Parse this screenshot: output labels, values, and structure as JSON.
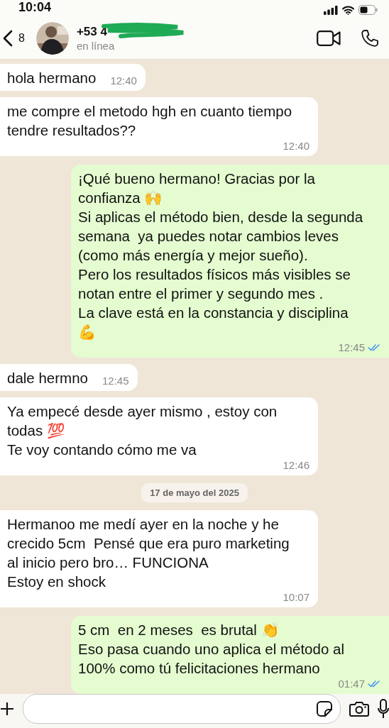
{
  "status_bar": {
    "time": "10:04"
  },
  "header": {
    "back_count": "8",
    "contact_name": "+53 4",
    "name_redacted": true,
    "presence": "en línea"
  },
  "messages": [
    {
      "kind": "message",
      "outgoing": false,
      "text": "hola hermano",
      "time": "12:40"
    },
    {
      "kind": "message",
      "outgoing": false,
      "text": "me compre el metodo hgh en cuanto tiempo\ntendre resultados??",
      "time": "12:40"
    },
    {
      "kind": "message",
      "outgoing": true,
      "text": "¡Qué bueno hermano! Gracias por la\nconfianza 🙌\nSi aplicas el método bien, desde la segunda\nsemana  ya puedes notar cambios leves\n(como más energía y mejor sueño).\nPero los resultados físicos más visibles se\nnotan entre el primer y segundo mes .\nLa clave está en la constancia y disciplina\n💪",
      "time": "12:45",
      "read": true
    },
    {
      "kind": "message",
      "outgoing": false,
      "text": "dale hermno",
      "time": "12:45"
    },
    {
      "kind": "message",
      "outgoing": false,
      "text": "Ya empecé desde ayer mismo , estoy con\ntodas 💯\nTe voy contando cómo me va",
      "time": "12:46"
    },
    {
      "kind": "date",
      "text": "17 de mayo del 2025"
    },
    {
      "kind": "message",
      "outgoing": false,
      "text": "Hermanoo me medí ayer en la noche y he\ncrecido 5cm  Pensé que era puro marketing\nal inicio pero bro… FUNCIONA\nEstoy en shock",
      "time": "10:07"
    },
    {
      "kind": "message",
      "outgoing": true,
      "text": "5 cm  en 2 meses  es brutal 👏\nEso pasa cuando uno aplica el método al\n100% como tú felicitaciones hermano",
      "time": "01:47",
      "read": true
    }
  ]
}
